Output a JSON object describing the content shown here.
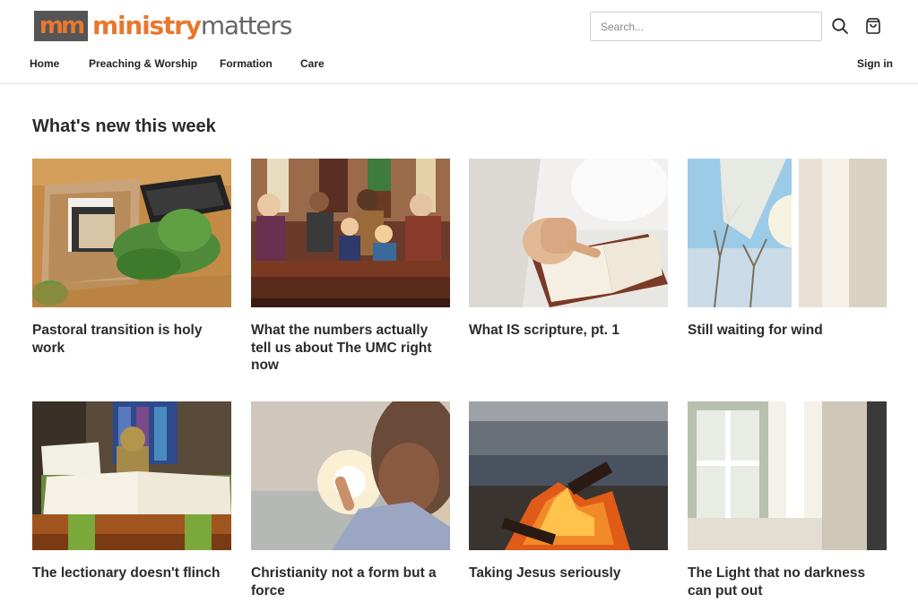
{
  "brand": {
    "mark": "mm",
    "word1": "ministry",
    "word2": "matters"
  },
  "search": {
    "placeholder": "Search..."
  },
  "icons": {
    "search": "search-icon",
    "cart": "shopping-bag-icon"
  },
  "nav": {
    "items": [
      {
        "label": "Home"
      },
      {
        "label": "Preaching & Worship"
      },
      {
        "label": "Formation"
      },
      {
        "label": "Care"
      }
    ],
    "signin": "Sign in"
  },
  "main": {
    "heading": "What's new this week",
    "cards": [
      {
        "title": "Pastoral transition is holy work"
      },
      {
        "title": "What the numbers actually tell us about The UMC right now"
      },
      {
        "title": "What IS scripture, pt. 1"
      },
      {
        "title": "Still waiting for wind"
      },
      {
        "title": "The lectionary doesn't flinch"
      },
      {
        "title": "Christianity not a form but a force"
      },
      {
        "title": "Taking Jesus seriously"
      },
      {
        "title": "The Light that no darkness can put out"
      }
    ]
  },
  "colors": {
    "brand_orange": "#e8782e",
    "brand_gray": "#555555",
    "text": "#222222"
  }
}
